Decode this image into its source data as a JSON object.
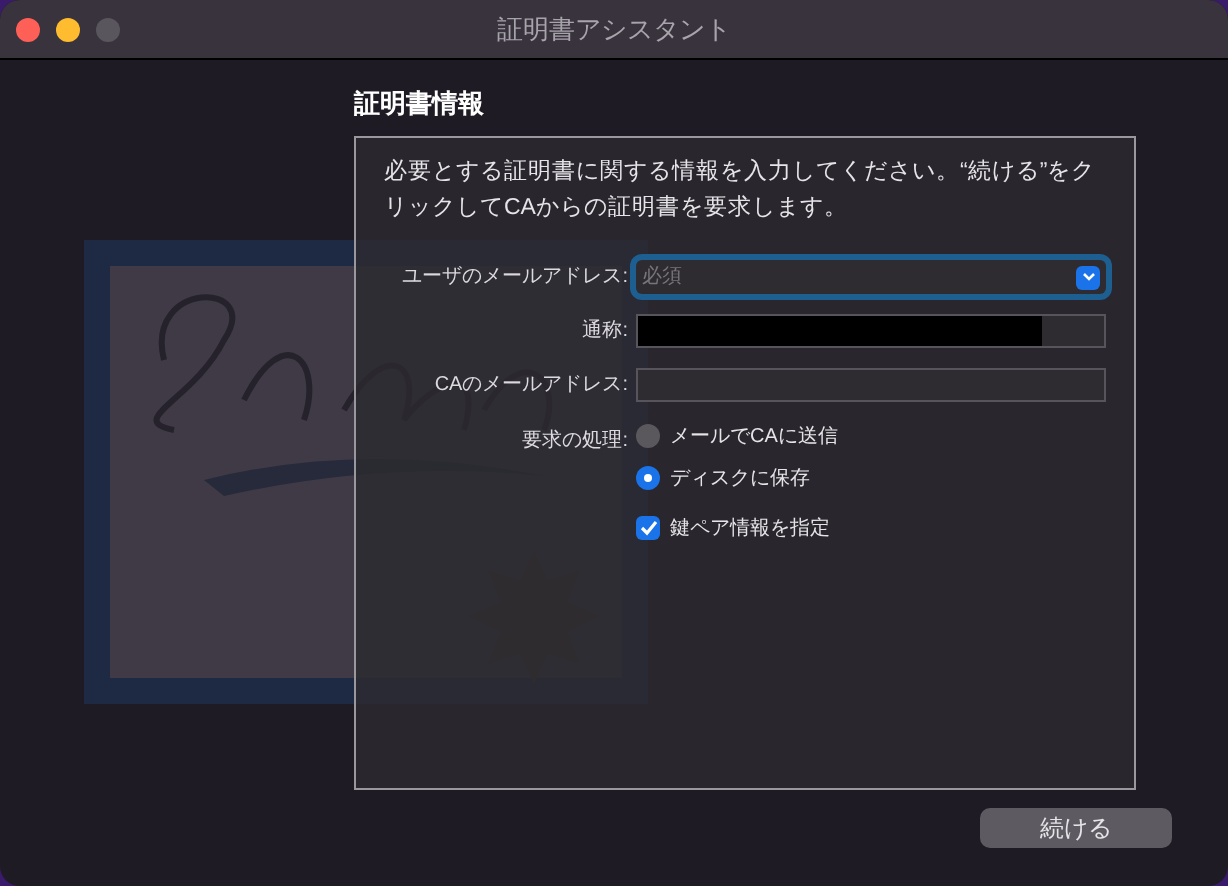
{
  "window": {
    "title": "証明書アシスタント"
  },
  "section_title": "証明書情報",
  "intro": "必要とする証明書に関する情報を入力してください。“続ける”をクリックしてCAからの証明書を要求します。",
  "fields": [
    {
      "kind": "combo",
      "label": "ユーザのメールアドレス:",
      "placeholder": "必須",
      "focused": true
    },
    {
      "kind": "redacted",
      "label": "通称:",
      "focused": false
    },
    {
      "kind": "text",
      "label": "CAのメールアドレス:",
      "focused": false
    }
  ],
  "request": {
    "label": "要求の処理:",
    "options": [
      {
        "label": "メールでCAに送信",
        "selected": false
      },
      {
        "label": "ディスクに保存",
        "selected": true
      }
    ]
  },
  "keypair": {
    "label": "鍵ペア情報を指定",
    "checked": true
  },
  "buttons": [
    "続ける"
  ]
}
